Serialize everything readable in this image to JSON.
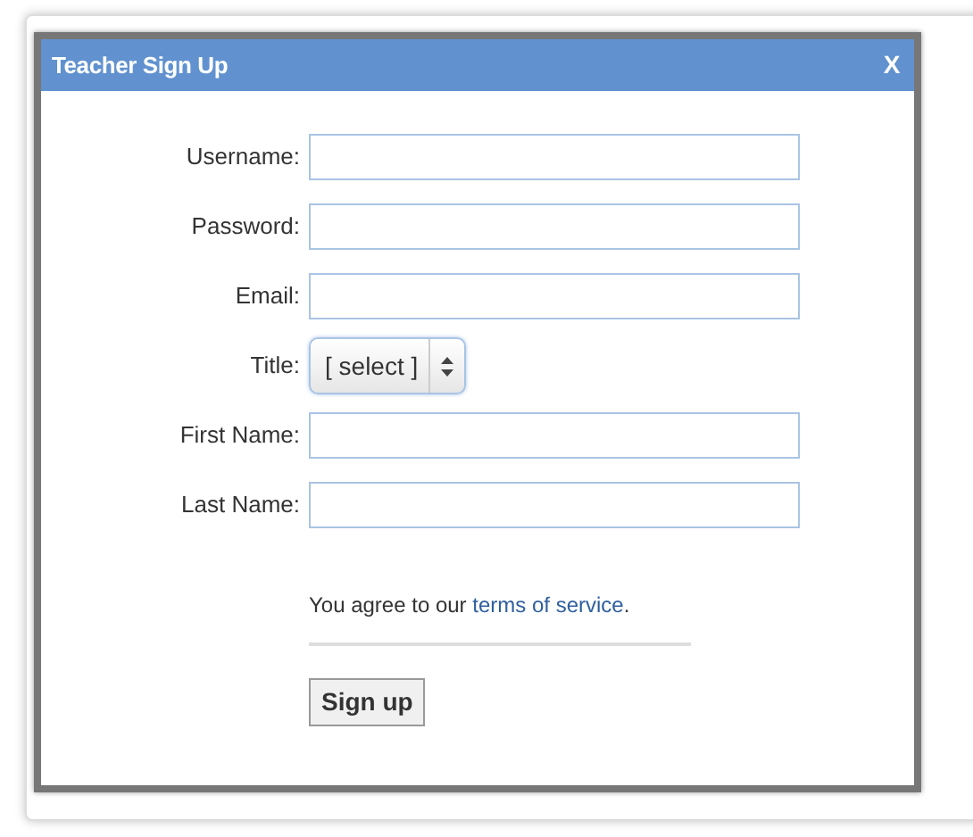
{
  "dialog": {
    "title": "Teacher Sign Up",
    "close": "X"
  },
  "fields": [
    {
      "kind": "text",
      "label": "Username:"
    },
    {
      "kind": "text",
      "label": "Password:"
    },
    {
      "kind": "text",
      "label": "Email:"
    },
    {
      "kind": "select",
      "label": "Title:",
      "value": "[ select ]"
    },
    {
      "kind": "text",
      "label": "First Name:"
    },
    {
      "kind": "text",
      "label": "Last Name:"
    }
  ],
  "agreement": {
    "text_before": "You agree to our ",
    "link": "terms of service",
    "text_after": "."
  },
  "submit": "Sign up"
}
